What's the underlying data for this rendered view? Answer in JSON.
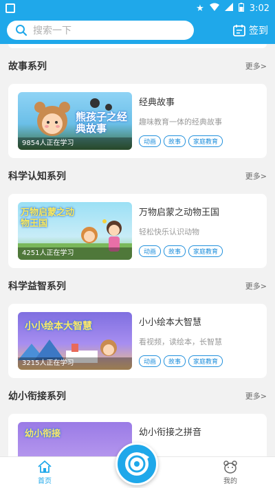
{
  "status_bar": {
    "time": "3:02"
  },
  "header": {
    "search_placeholder": "搜索一下",
    "signin_label": "签到"
  },
  "sections": [
    {
      "title": "故事系列",
      "more": "更多>",
      "card": {
        "thumb_title": "熊孩子之经典故事",
        "learners": "9854人正在学习",
        "title": "经典故事",
        "desc": "趣味教育一体的经典故事",
        "tags": [
          "动画",
          "故事",
          "家庭教育"
        ]
      }
    },
    {
      "title": "科学认知系列",
      "more": "更多>",
      "card": {
        "thumb_title": "万物启蒙之动物王国",
        "learners": "4251人正在学习",
        "title": "万物启蒙之动物王国",
        "desc": "轻松快乐认识动物",
        "tags": [
          "动画",
          "故事",
          "家庭教育"
        ]
      }
    },
    {
      "title": "科学益智系列",
      "more": "更多>",
      "card": {
        "thumb_title": "小小绘本大智慧",
        "learners": "3215人正在学习",
        "title": "小小绘本大智慧",
        "desc": "看视频，读绘本，长智慧",
        "tags": [
          "动画",
          "故事",
          "家庭教育"
        ]
      }
    },
    {
      "title": "幼小衔接系列",
      "more": "更多>",
      "card": {
        "thumb_title": "幼小衔接",
        "learners": "",
        "title": "幼小衔接之拼音",
        "desc": "",
        "tags": []
      }
    }
  ],
  "bottom_nav": {
    "home": "首页",
    "me": "我的"
  },
  "colors": {
    "primary": "#1fa8ea",
    "tag": "#1f8fdc"
  }
}
